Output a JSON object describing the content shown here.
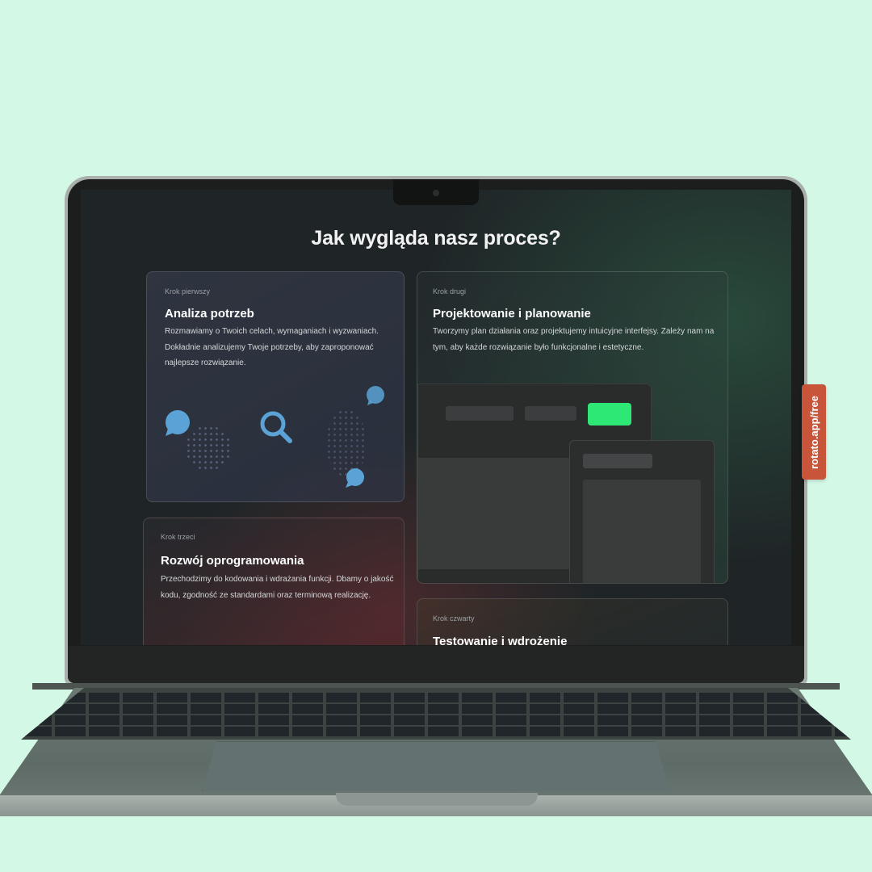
{
  "side_tag": "rotato.app/free",
  "page": {
    "title": "Jak wygląda nasz proces?"
  },
  "cards": [
    {
      "step": "Krok pierwszy",
      "title": "Analiza potrzeb",
      "body": "Rozmawiamy o Twoich celach, wymaganiach i wyzwaniach. Dokładnie analizujemy Twoje potrzeby, aby zaproponować najlepsze rozwiązanie."
    },
    {
      "step": "Krok drugi",
      "title": "Projektowanie i planowanie",
      "body": "Tworzymy plan działania oraz projektujemy intuicyjne interfejsy. Zależy nam na tym, aby każde rozwiązanie było funkcjonalne i estetyczne."
    },
    {
      "step": "Krok trzeci",
      "title": "Rozwój oprogramowania",
      "body": "Przechodzimy do kodowania i wdrażania funkcji. Dbamy o jakość kodu, zgodność ze standardami oraz terminową realizację."
    },
    {
      "step": "Krok czwarty",
      "title": "Testowanie i wdrożenie"
    }
  ],
  "icons": [
    "chat-bubble-icon",
    "search-icon",
    "chat-bubble-icon",
    "chat-bubble-icon"
  ],
  "colors": {
    "background": "#d3f8e6",
    "accent_green": "#2ee876",
    "icon_blue": "#5ba3d6",
    "side_tag": "#c8553a"
  }
}
